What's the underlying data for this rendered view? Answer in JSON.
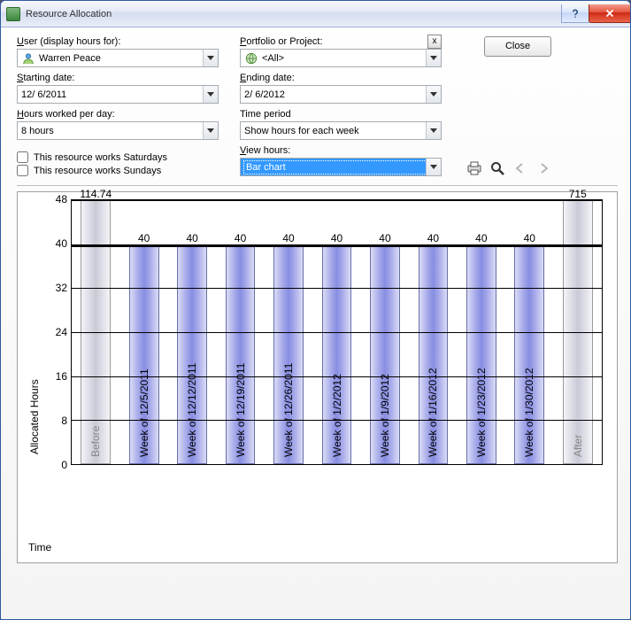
{
  "window": {
    "title": "Resource Allocation"
  },
  "buttons": {
    "close": "Close",
    "clear_project": "x"
  },
  "labels": {
    "user": "User (display hours for):",
    "portfolio": "Portfolio or Project:",
    "starting": "Starting date:",
    "ending": "Ending date:",
    "hours_per_day": "Hours worked per day:",
    "time_period": "Time period",
    "works_sat": "This resource works Saturdays",
    "works_sun": "This resource works Sundays",
    "view_hours": "View hours:"
  },
  "hotkeys": {
    "user": "U",
    "portfolio": "P",
    "starting": "S",
    "ending": "E",
    "hours_per_day": "H",
    "view_hours": "V"
  },
  "fields": {
    "user": "Warren Peace",
    "portfolio": "<All>",
    "starting_date": "12/ 6/2011",
    "ending_date": "2/ 6/2012",
    "hours_per_day": "8 hours",
    "time_period": "Show hours for each week",
    "works_sat": false,
    "works_sun": false,
    "view_hours": "Bar chart"
  },
  "chart_data": {
    "type": "bar",
    "title": "",
    "xlabel": "Time",
    "ylabel": "Allocated Hours",
    "ylim": [
      0,
      48
    ],
    "yticks": [
      0,
      8,
      16,
      24,
      32,
      40,
      48
    ],
    "baseline": 40,
    "categories": [
      "Before",
      "Week of 12/5/2011",
      "Week of 12/12/2011",
      "Week of 12/19/2011",
      "Week of 12/26/2011",
      "Week of 1/2/2012",
      "Week of 1/9/2012",
      "Week of 1/16/2012",
      "Week of 1/23/2012",
      "Week of 1/30/2012",
      "After"
    ],
    "values": [
      114.74,
      40,
      40,
      40,
      40,
      40,
      40,
      40,
      40,
      40,
      715
    ],
    "edge_indices": [
      0,
      10
    ]
  }
}
